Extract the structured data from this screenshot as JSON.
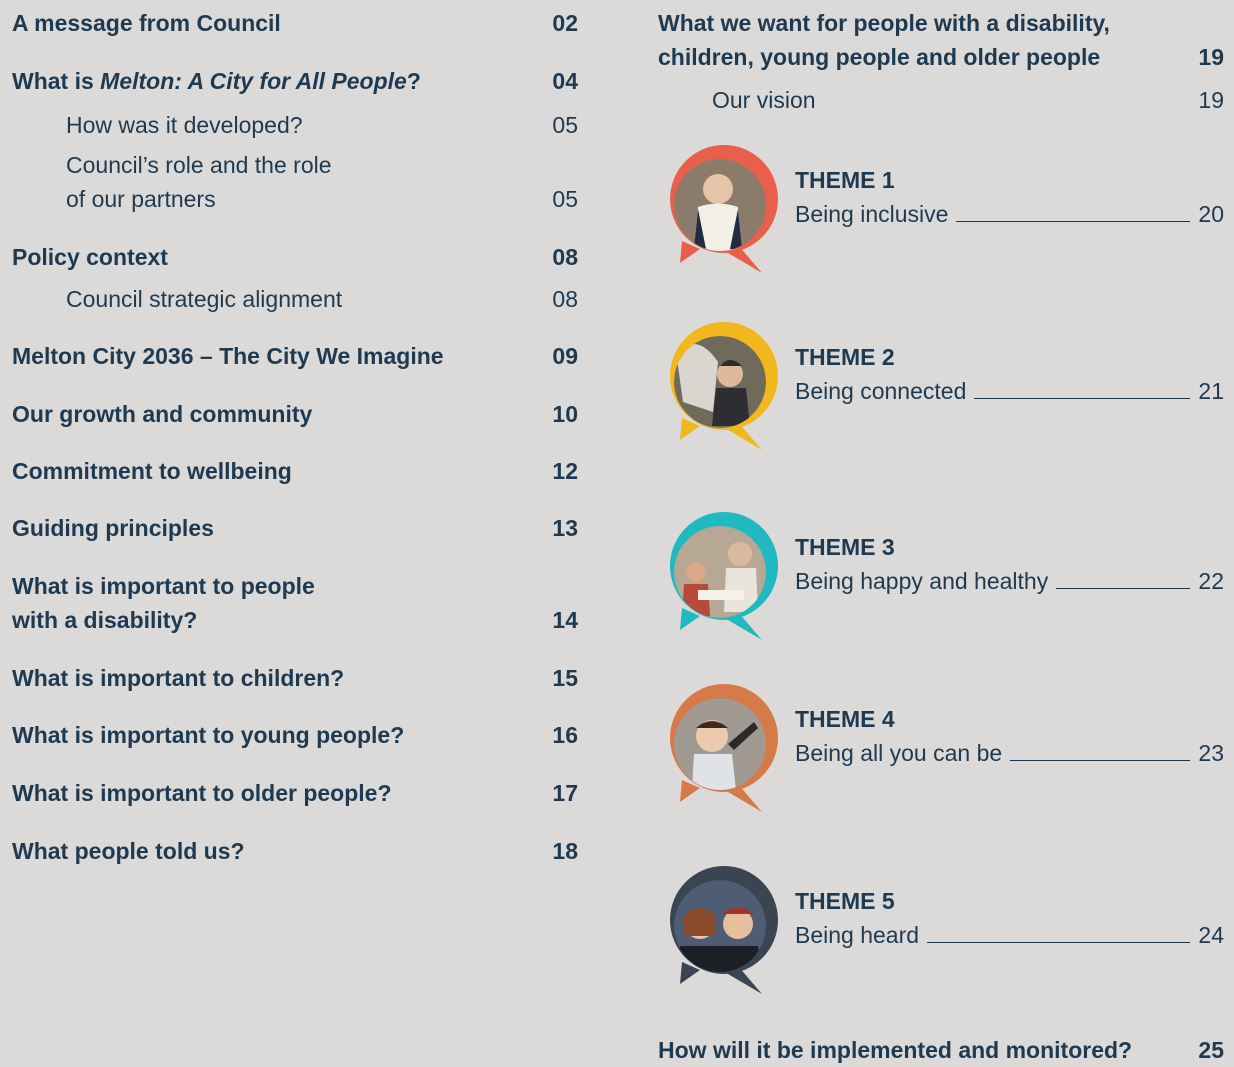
{
  "left_toc": {
    "message": {
      "title": "A message from Council",
      "page": "02"
    },
    "what_is": {
      "title_prefix": "What is ",
      "title_em": "Melton: A City for All People",
      "title_suffix": "?",
      "page": "04"
    },
    "developed": {
      "title": "How was it developed?",
      "page": "05"
    },
    "role": {
      "line1": "Council’s role and the role",
      "line2": "of our partners",
      "page": "05"
    },
    "policy": {
      "title": "Policy context",
      "page": "08"
    },
    "alignment": {
      "title": "Council strategic alignment",
      "page": "08"
    },
    "city2036": {
      "title": "Melton City 2036 – The City We Imagine",
      "page": "09"
    },
    "growth": {
      "title": "Our growth and community",
      "page": "10"
    },
    "wellbeing": {
      "title": "Commitment to wellbeing",
      "page": "12"
    },
    "principles": {
      "title": "Guiding principles",
      "page": "13"
    },
    "disability": {
      "line1": "What is important to people",
      "line2": "with a disability?",
      "page": "14"
    },
    "children": {
      "title": "What is important to children?",
      "page": "15"
    },
    "young": {
      "title": "What is important to young people?",
      "page": "16"
    },
    "older": {
      "title": "What is important to older people?",
      "page": "17"
    },
    "told": {
      "title": "What people told us?",
      "page": "18"
    }
  },
  "right_toc": {
    "want": {
      "line1": "What we want for people with a disability,",
      "line2": "children, young people and older people",
      "page": "19"
    },
    "vision": {
      "title": "Our vision",
      "page": "19"
    },
    "themes": [
      {
        "label": "THEME 1",
        "title": "Being inclusive",
        "page": "20",
        "color": "#e8604c",
        "icon": "girl-photo"
      },
      {
        "label": "THEME 2",
        "title": "Being connected",
        "page": "21",
        "color": "#f0b81c",
        "icon": "child-horse-photo"
      },
      {
        "label": "THEME 3",
        "title": "Being happy and healthy",
        "page": "22",
        "color": "#1fb9bf",
        "icon": "family-dining-photo"
      },
      {
        "label": "THEME 4",
        "title": "Being all you can be",
        "page": "23",
        "color": "#d77a4a",
        "icon": "child-playing-photo"
      },
      {
        "label": "THEME 5",
        "title": "Being heard",
        "page": "24",
        "color": "#3a4453",
        "icon": "two-women-photo"
      }
    ],
    "implemented": {
      "title": "How will it be implemented and monitored?",
      "page": "25"
    }
  }
}
